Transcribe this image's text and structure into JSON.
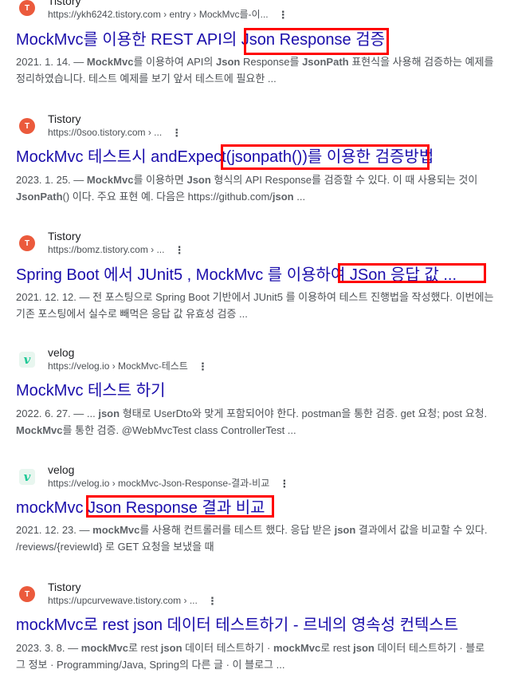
{
  "results": [
    {
      "favicon": "tistory-icon",
      "site_name": "Tistory",
      "url": "https://ykh6242.tistory.com › entry › MockMvc를-이...",
      "title": "MockMvc를 이용한 REST API의 Json Response 검증",
      "snippet_date": "2021. 1. 14.",
      "snippet_parts": [
        " — ",
        "MockMvc",
        "를 이용하여 API의 ",
        "Json",
        " Response를 ",
        "JsonPath",
        " 표현식을 사용해 검증하는 예제를 정리하였습니다. 테스트 예제를 보기 앞서 테스트에 필요한 ..."
      ]
    },
    {
      "favicon": "tistory-icon",
      "site_name": "Tistory",
      "url": "https://0soo.tistory.com › ...",
      "title": "MockMvc 테스트시 andExpect(jsonpath())를 이용한 검증방법",
      "snippet_date": "2023. 1. 25.",
      "snippet_parts": [
        " — ",
        "MockMvc",
        "를 이용하면 ",
        "Json",
        " 형식의 API Response를 검증할 수 있다. 이 때 사용되는 것이 ",
        "JsonPath",
        "() 이다. 주요 표현 예. 다음은 https://github.com/",
        "json",
        " ..."
      ]
    },
    {
      "favicon": "tistory-icon",
      "site_name": "Tistory",
      "url": "https://bomz.tistory.com › ...",
      "title": "Spring Boot 에서 JUnit5 , MockMvc 를 이용하여 JSon 응답 값 ...",
      "snippet_date": "2021. 12. 12.",
      "snippet_parts": [
        " — 전 포스팅으로 Spring Boot 기반에서 JUnit5 를 이용하여 테스트 진행법을 작성했다. 이번에는 기존 포스팅에서 실수로 빼먹은 응답 값 유효성 검증 ..."
      ]
    },
    {
      "favicon": "velog-icon",
      "site_name": "velog",
      "url": "https://velog.io › MockMvc-테스트",
      "title": "MockMvc 테스트 하기",
      "snippet_date": "2022. 6. 27.",
      "snippet_parts": [
        " — ... ",
        "json",
        " 형태로 UserDto와 맞게 포함되어야 한다. postman을 통한 검증. get 요청; post 요청. ",
        "MockMvc",
        "를 통한 검증. @WebMvcTest class ControllerTest ..."
      ]
    },
    {
      "favicon": "velog-icon",
      "site_name": "velog",
      "url": "https://velog.io › mockMvc-Json-Response-결과-비교",
      "title": "mockMvc Json Response 결과 비교",
      "snippet_date": "2021. 12. 23.",
      "snippet_parts": [
        " — ",
        "mockMvc",
        "를 사용해 컨트롤러를 테스트 했다. 응답 받은 ",
        "json",
        " 결과에서 값을 비교할 수 있다. /reviews/{reviewId} 로 GET 요청을 보냈을 때"
      ]
    },
    {
      "favicon": "tistory-icon",
      "site_name": "Tistory",
      "url": "https://upcurvewave.tistory.com › ...",
      "title": "mockMvc로 rest json 데이터 테스트하기 - 르네의 영속성 컨텍스트",
      "snippet_date": "2023. 3. 8.",
      "snippet_parts": [
        " — ",
        "mockMvc",
        "로 rest ",
        "json",
        " 데이터 테스트하기 · ",
        "mockMvc",
        "로 rest ",
        "json",
        " 데이터 테스트하기 · 블로그 정보 · Programming/Java, Spring의 다른 글 · 이 블로그 ..."
      ]
    }
  ],
  "colors": {
    "title_link": "#1a0dab",
    "highlight_box": "#ff0000",
    "tistory": "#eb5a3c",
    "velog": "#20c997"
  }
}
